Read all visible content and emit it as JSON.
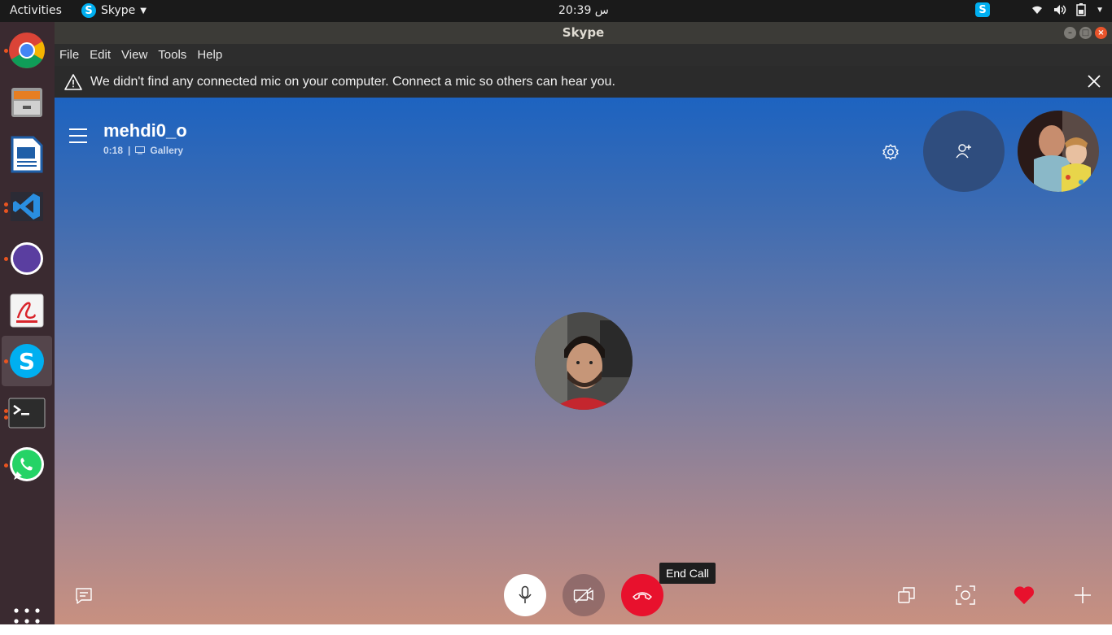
{
  "topbar": {
    "activities": "Activities",
    "app_name": "Skype",
    "clock": "20:39 س"
  },
  "window": {
    "title": "Skype"
  },
  "menubar": {
    "items": [
      "File",
      "Edit",
      "View",
      "Tools",
      "Help"
    ]
  },
  "banner": {
    "message": "We didn't find any connected mic on your computer. Connect a mic so others can hear you."
  },
  "call": {
    "contact_name": "mehdi0_o",
    "duration": "0:18",
    "separator": "|",
    "view_mode": "Gallery",
    "end_call_tooltip": "End Call"
  },
  "dock": {
    "apps": [
      "chrome-icon",
      "file-manager-icon",
      "writer-icon",
      "vscode-icon",
      "tor-icon",
      "pdf-reader-icon",
      "skype-icon",
      "terminal-icon",
      "whatsapp-icon"
    ]
  },
  "colors": {
    "end_call": "#e8112d",
    "skype_blue": "#00aff0",
    "ubuntu_orange": "#e95420",
    "heart": "#e8112d"
  }
}
